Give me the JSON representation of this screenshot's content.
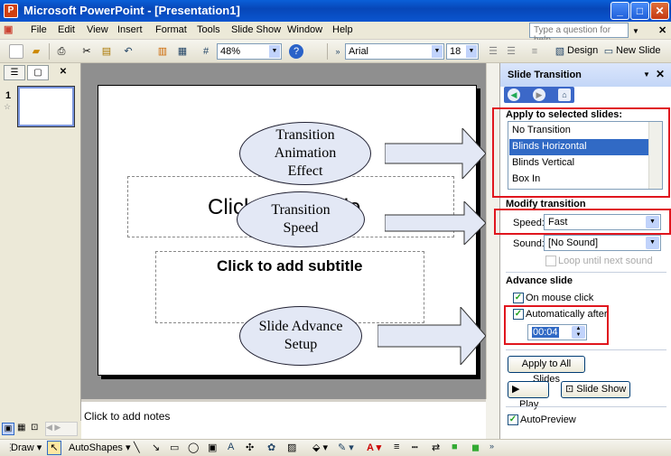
{
  "window": {
    "title": "Microsoft PowerPoint - [Presentation1]",
    "min": "_",
    "max": "□",
    "close": "✕"
  },
  "menu": [
    "File",
    "Edit",
    "View",
    "Insert",
    "Format",
    "Tools",
    "Slide Show",
    "Window",
    "Help"
  ],
  "help_placeholder": "Type a question for help",
  "toolbar": {
    "zoom": "48%",
    "font": "Arial",
    "size": "18",
    "design": "Design",
    "new_slide": "New Slide"
  },
  "slide": {
    "title_placeholder": "Click to add title",
    "subtitle_placeholder": "Click to add subtitle",
    "callouts": [
      "Transition Animation Effect",
      "Transition Speed",
      "Slide Advance Setup"
    ]
  },
  "thumb_number": "1",
  "notes_placeholder": "Click to add notes",
  "task_pane": {
    "title": "Slide Transition",
    "apply_heading": "Apply to selected slides:",
    "transitions": [
      "No Transition",
      "Blinds Horizontal",
      "Blinds Vertical",
      "Box In"
    ],
    "selected_transition": "Blinds Horizontal",
    "modify_heading": "Modify transition",
    "speed_label": "Speed:",
    "speed_value": "Fast",
    "sound_label": "Sound:",
    "sound_value": "[No Sound]",
    "loop_label": "Loop until next sound",
    "advance_heading": "Advance slide",
    "on_click_label": "On mouse click",
    "auto_label": "Automatically after",
    "auto_time": "00:04",
    "apply_all": "Apply to All Slides",
    "play": "Play",
    "slide_show": "Slide Show",
    "autopreview": "AutoPreview"
  },
  "drawbar": {
    "draw": "Draw",
    "autoshapes": "AutoShapes"
  },
  "colors": {
    "highlight": "#e0161e",
    "selection": "#316ac5",
    "titlebar": "#0a5fd8"
  }
}
